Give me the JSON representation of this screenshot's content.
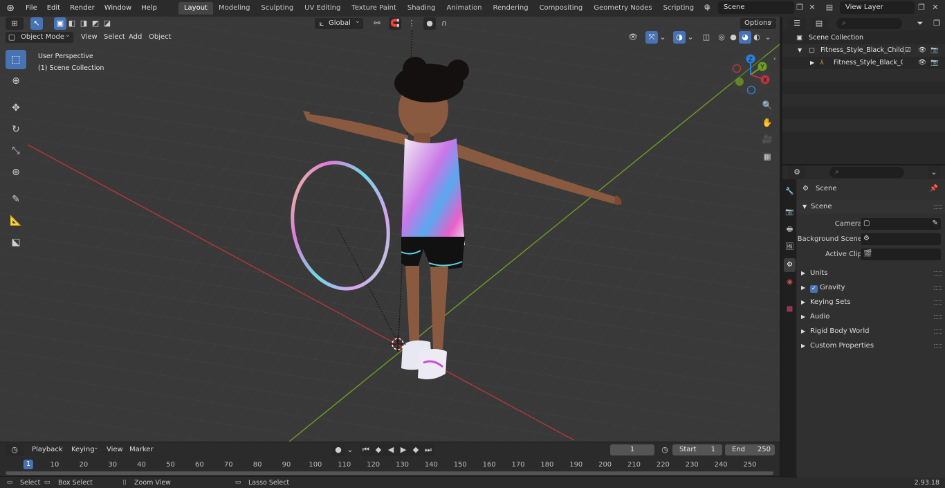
{
  "menubar": {
    "items": [
      "File",
      "Edit",
      "Render",
      "Window",
      "Help"
    ]
  },
  "workspaces": {
    "tabs": [
      "Layout",
      "Modeling",
      "Sculpting",
      "UV Editing",
      "Texture Paint",
      "Shading",
      "Animation",
      "Rendering",
      "Compositing",
      "Geometry Nodes",
      "Scripting"
    ],
    "active": "Layout",
    "add_label": "+"
  },
  "scene_selector": {
    "value": "Scene"
  },
  "view_layer_selector": {
    "value": "View Layer"
  },
  "viewport": {
    "mode": "Object Mode",
    "menus": [
      "View",
      "Select",
      "Add",
      "Object"
    ],
    "transform_orientation": "Global",
    "options_label": "Options",
    "overlay_title": "User Perspective",
    "overlay_collection": "(1) Scene Collection",
    "gizmo": {
      "z": "Z",
      "y": "Y",
      "x": "X"
    }
  },
  "outliner": {
    "search_placeholder": "",
    "root": "Scene Collection",
    "rows": [
      {
        "label": "Fitness_Style_Black_Child_Gir"
      },
      {
        "label": "Fitness_Style_Black_Chik"
      }
    ]
  },
  "properties": {
    "search_placeholder": "",
    "breadcrumb": "Scene",
    "section_title": "Scene",
    "fields": {
      "camera_label": "Camera",
      "background_scene_label": "Background Scene",
      "active_clip_label": "Active Clip"
    },
    "collapsed_sections": [
      "Units",
      "Gravity",
      "Keying Sets",
      "Audio",
      "Rigid Body World",
      "Custom Properties"
    ],
    "gravity_checked": true
  },
  "timeline": {
    "menus": [
      "Playback",
      "Keying",
      "View",
      "Marker"
    ],
    "current_frame": "1",
    "start_label": "Start",
    "start_value": "1",
    "end_label": "End",
    "end_value": "250",
    "ruler": [
      "1",
      "10",
      "20",
      "30",
      "40",
      "50",
      "60",
      "70",
      "80",
      "90",
      "100",
      "110",
      "120",
      "130",
      "140",
      "150",
      "160",
      "170",
      "180",
      "190",
      "200",
      "210",
      "220",
      "230",
      "240",
      "250"
    ]
  },
  "statusbar": {
    "select": "Select",
    "box_select": "Box Select",
    "zoom_view": "Zoom View",
    "lasso_select": "Lasso Select",
    "version": "2.93.18"
  },
  "colors": {
    "accent": "#4772b3",
    "x_axis": "#b5363f",
    "y_axis": "#6f9e24",
    "z_axis": "#2e80d6"
  }
}
